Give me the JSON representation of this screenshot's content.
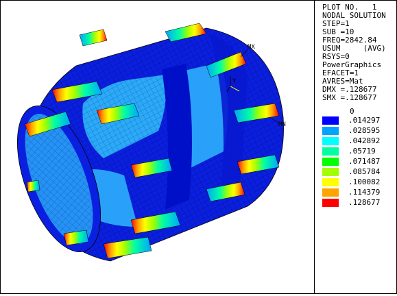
{
  "info": [
    "PLOT NO.   1",
    "NODAL SOLUTION",
    "STEP=1",
    "SUB =10",
    "FREQ=2842.84",
    "USUM     (AVG)",
    "RSYS=0",
    "PowerGraphics",
    "EFACET=1",
    "AVRES=Mat",
    "DMX =.128677",
    "SMX =.128677"
  ],
  "legend": {
    "zero": "0",
    "entries": [
      {
        "color": "#0000ff",
        "value": ".014297"
      },
      {
        "color": "#00a3ff",
        "value": ".028595"
      },
      {
        "color": "#00ffff",
        "value": ".042892"
      },
      {
        "color": "#00ffa3",
        "value": ".05719"
      },
      {
        "color": "#00ff00",
        "value": ".071487"
      },
      {
        "color": "#a3ff00",
        "value": ".085784"
      },
      {
        "color": "#ffff00",
        "value": ".100082"
      },
      {
        "color": "#ffa300",
        "value": ".114379"
      },
      {
        "color": "#ff0000",
        "value": ".128677"
      }
    ]
  },
  "markers": {
    "max_label": "MX",
    "min_label": "MN",
    "axis_label": "Y"
  }
}
